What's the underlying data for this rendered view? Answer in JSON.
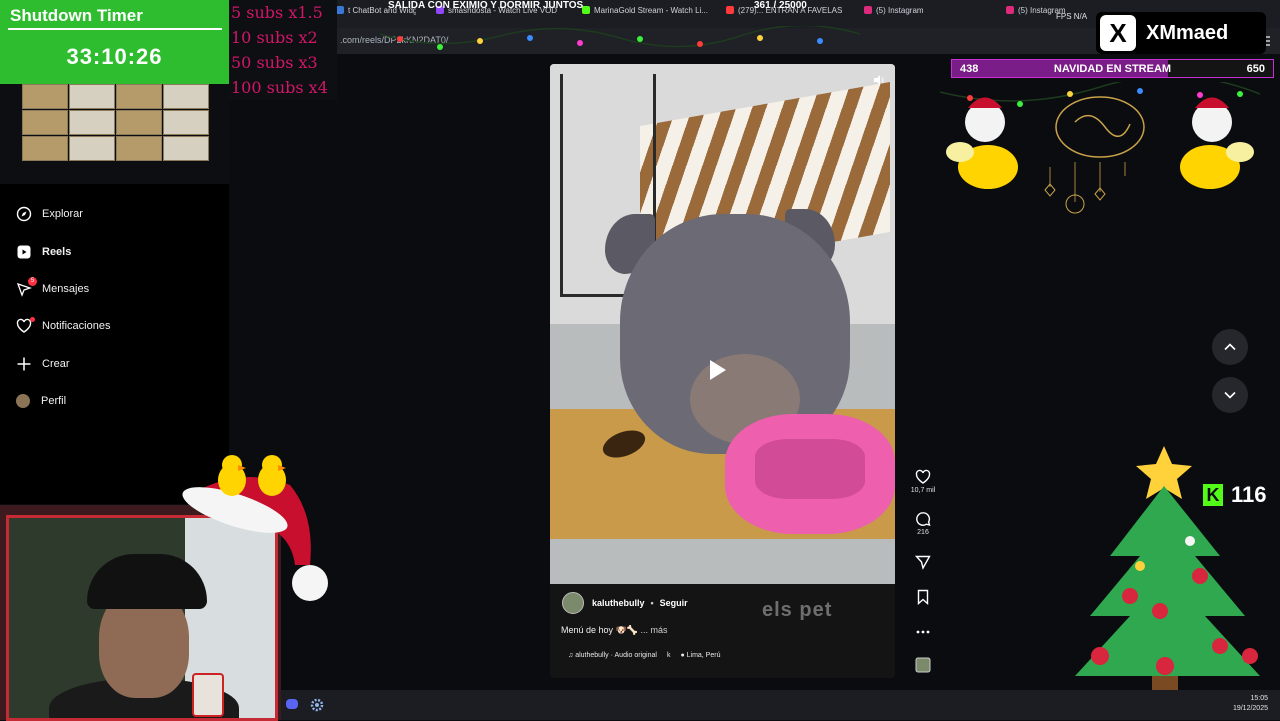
{
  "browser": {
    "tabs": [
      {
        "label": "t ChatBot and Widgets",
        "color": "#3a78d8"
      },
      {
        "label": "smashdosta - Watch Live VOD",
        "color": "#9146ff"
      },
      {
        "label": "MarinaGold Stream - Watch Li...",
        "color": "#53fc18"
      },
      {
        "label": "(279)... ENTRAN A FAVELAS",
        "color": "#ff3b3b"
      },
      {
        "label": "(5) Instagram",
        "color": "#dd2a7b"
      },
      {
        "label": "(5) Instagram",
        "color": "#dd2a7b"
      }
    ],
    "url": ".com/reels/DP2kKN2DAT0/",
    "status_right": "FPS  N/A"
  },
  "overlay": {
    "timer_title": "Shutdown Timer",
    "timer_value": "33:10:26",
    "subs": [
      "5 subs x1.5",
      "10 subs x2",
      "50 subs x3",
      "100 subs x4"
    ],
    "headline": "SALIDA CON EXIMIO Y DORMIR JUNTOS",
    "counter": "361  / 25000",
    "x_handle": "XMmaed",
    "x_logo": "X",
    "goal_left": "438",
    "goal_label": "NAVIDAD EN STREAM",
    "goal_right": "650",
    "goal_progress": 0.674,
    "kick_letter": "K",
    "kick_count": "116"
  },
  "sidebar": {
    "items": [
      {
        "label": "Explorar",
        "icon": "compass-icon",
        "bold": false
      },
      {
        "label": "Reels",
        "icon": "reels-icon",
        "bold": true
      },
      {
        "label": "Mensajes",
        "icon": "messenger-icon",
        "bold": false,
        "badge": "5"
      },
      {
        "label": "Notificaciones",
        "icon": "heart-icon",
        "bold": false
      },
      {
        "label": "Crear",
        "icon": "plus-icon",
        "bold": false
      },
      {
        "label": "Perfil",
        "icon": "avatar-icon",
        "bold": false
      }
    ]
  },
  "reel": {
    "author": "kaluthebully",
    "follow_label": "Seguir",
    "caption": "Menú de hoy 🐶🦴",
    "more_label": "... más",
    "audio": "aluthebully · Audio original",
    "audio_extra": "k",
    "location": "Lima, Perú",
    "watermark": "els pet",
    "likes": "10,7 mil",
    "comments": "216"
  },
  "taskbar": {
    "time": "15:05",
    "date": "19/12/2025"
  },
  "colors": {
    "timer_green": "#2ebd2e",
    "subs_pink": "#d1166a",
    "goal_border": "#c92fd7",
    "kick_green": "#53fc18"
  }
}
